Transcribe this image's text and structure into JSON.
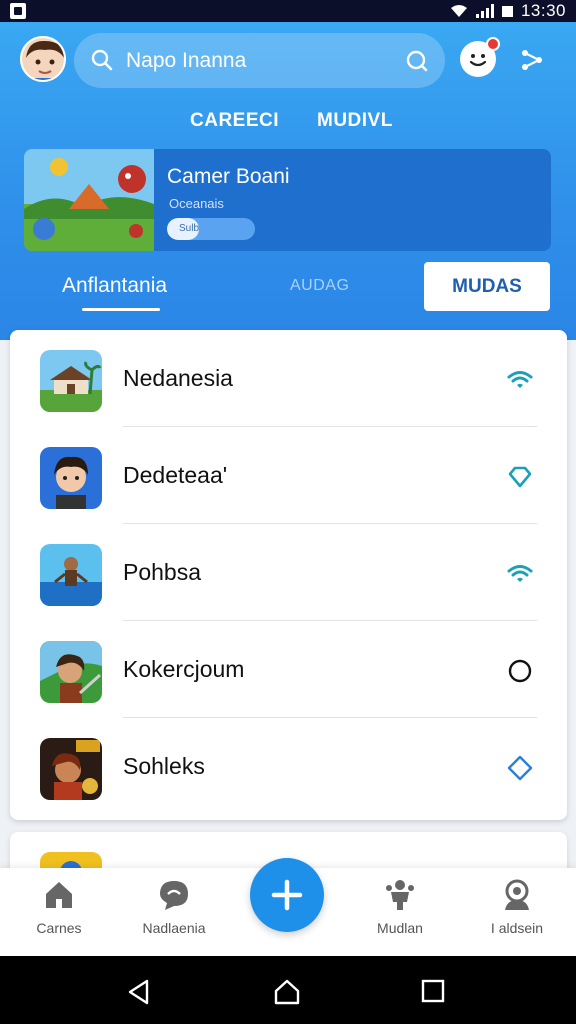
{
  "status_bar": {
    "time": "13:30"
  },
  "header": {
    "search_text": "Napo Inanna",
    "top_tabs": [
      "CAREECI",
      "MUDIVL"
    ],
    "featured": {
      "title": "Camer Boani",
      "subtitle": "Oceanais",
      "progress_label": "Sulb",
      "progress": 0.36
    },
    "sub_tabs": {
      "active": "Anflantania",
      "middle": "AUDAG",
      "button": "MUDAS"
    }
  },
  "list": {
    "items": [
      {
        "label": "Nedanesia",
        "status_icon": "wifi-icon",
        "status_color": "#1aa0b8"
      },
      {
        "label": "Dedeteaa'",
        "status_icon": "diamond-outline-icon",
        "status_color": "#1aa0b8"
      },
      {
        "label": "Pohbsa",
        "status_icon": "wifi-icon",
        "status_color": "#1aa0b8"
      },
      {
        "label": "Kokercjoum",
        "status_icon": "circle-outline-icon",
        "status_color": "#111111"
      },
      {
        "label": "Sohleks",
        "status_icon": "diamond-outline-icon",
        "status_color": "#2a7fd6"
      }
    ]
  },
  "bottom_nav": {
    "items": [
      {
        "label": "Carnes",
        "icon": "home-icon"
      },
      {
        "label": "Nadlaenia",
        "icon": "chat-icon"
      },
      {
        "label": "Mudlan",
        "icon": "person-icon"
      },
      {
        "label": "I aldsein",
        "icon": "profile-icon"
      }
    ],
    "fab_icon": "plus-icon"
  },
  "colors": {
    "accent": "#2f8fea",
    "fab": "#1e90ea",
    "button_text": "#1f5fae"
  }
}
